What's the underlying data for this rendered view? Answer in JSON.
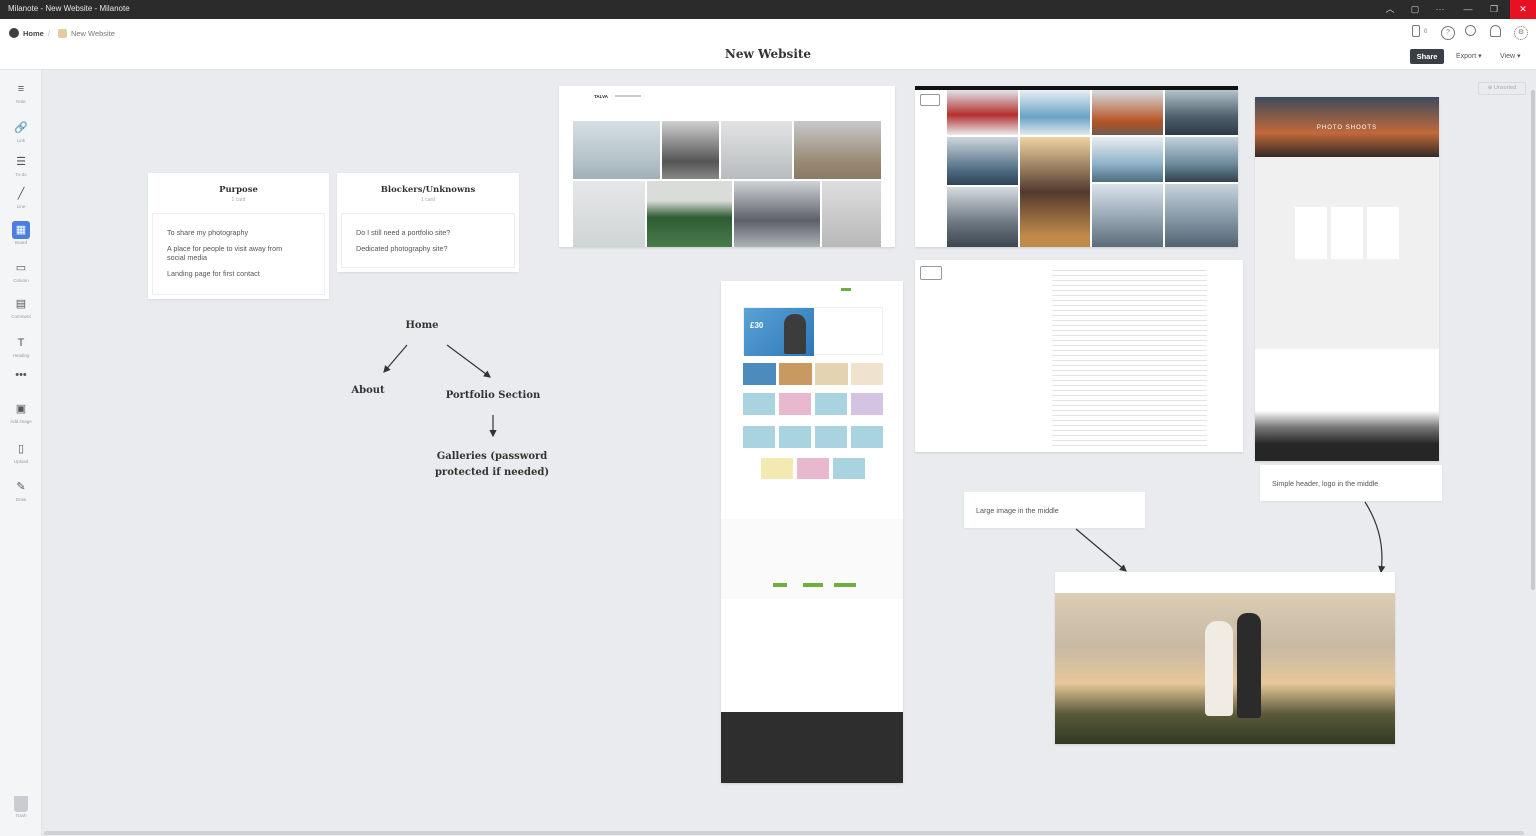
{
  "window": {
    "title": "Milanote - New Website - Milanote"
  },
  "breadcrumb": {
    "home": "Home",
    "current": "New Website"
  },
  "board": {
    "title": "New Website"
  },
  "header": {
    "share": "Share",
    "export": "Export ▾",
    "view": "View ▾",
    "device_count": "0"
  },
  "toolbar": [
    {
      "label": "Note",
      "icon": "note-icon",
      "glyph": "≡"
    },
    {
      "label": "Link",
      "icon": "link-icon",
      "glyph": "🔗"
    },
    {
      "label": "To-do",
      "icon": "todo-icon",
      "glyph": "☰"
    },
    {
      "label": "Line",
      "icon": "line-icon",
      "glyph": "╱"
    },
    {
      "label": "Board",
      "icon": "board-icon",
      "glyph": "▦"
    },
    {
      "label": "Column",
      "icon": "column-icon",
      "glyph": "▭"
    },
    {
      "label": "Comment",
      "icon": "comment-icon",
      "glyph": "▤"
    },
    {
      "label": "Heading",
      "icon": "heading-icon",
      "glyph": "T"
    },
    {
      "label": "",
      "icon": "more-icon",
      "glyph": "•••"
    },
    {
      "label": "Add image",
      "icon": "add-image-icon",
      "glyph": "▣"
    },
    {
      "label": "Upload",
      "icon": "upload-icon",
      "glyph": "▯"
    },
    {
      "label": "Draw",
      "icon": "draw-icon",
      "glyph": "✎"
    }
  ],
  "trash": {
    "label": "Trash"
  },
  "cards": {
    "purpose": {
      "title": "Purpose",
      "sub": "1 card",
      "items": [
        "To share my photography",
        "A place for people to visit away from social media",
        "Landing page for first contact"
      ]
    },
    "blockers": {
      "title": "Blockers/Unknowns",
      "sub": "1 card",
      "items": [
        "Do I still need a portfolio site?",
        "Dedicated photography site?"
      ]
    }
  },
  "sitemap": {
    "home": "Home",
    "about": "About",
    "portfolio": "Portfolio Section",
    "galleries": "Galleries (password protected if needed)"
  },
  "notes": {
    "large_image": "Large image in the middle",
    "simple_header": "Simple header, logo in the middle"
  },
  "unsorted": "Unsorted",
  "screenshot_text": {
    "brand": "TALVA",
    "photo_shoots": "PHOTO SHOOTS",
    "price": "£30"
  }
}
